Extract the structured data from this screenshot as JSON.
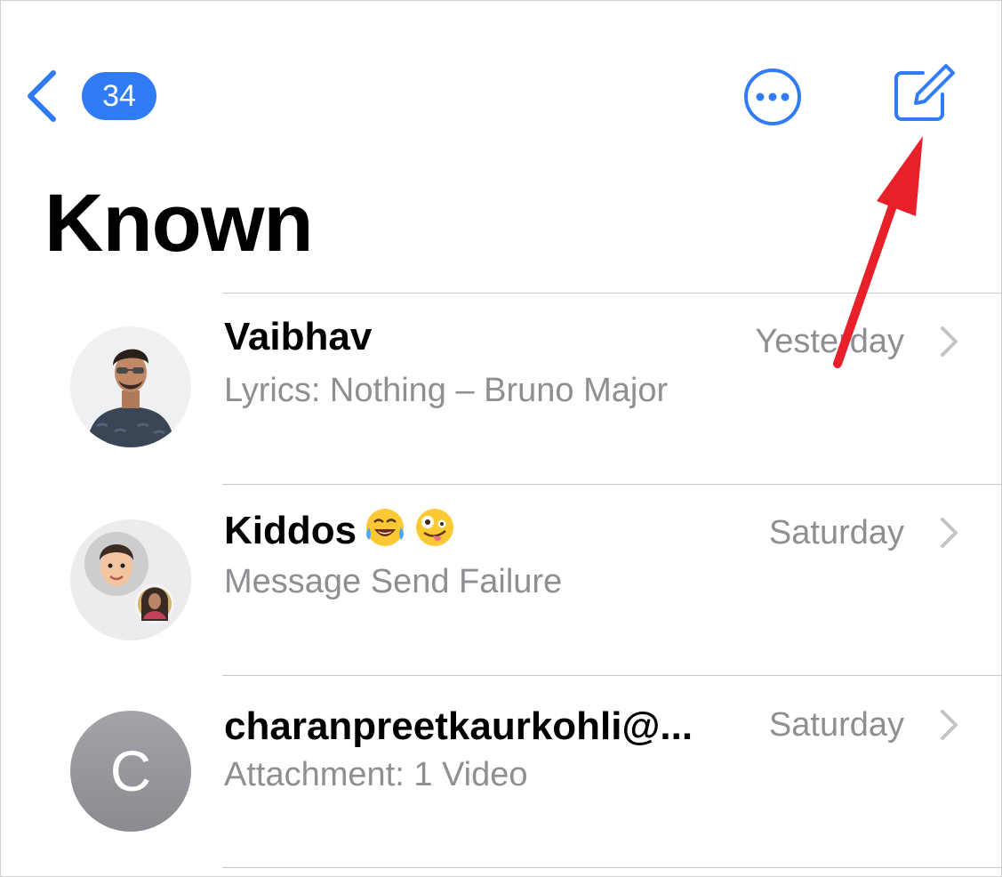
{
  "nav": {
    "unread_count": "34",
    "back_icon": "chevron-left-icon",
    "more_icon": "ellipsis-circle-icon",
    "compose_icon": "compose-icon"
  },
  "page_title": "Known",
  "colors": {
    "accent": "#2f7cf6",
    "secondary_text": "#8e8e93",
    "annotation_arrow": "#e8202a"
  },
  "conversations": [
    {
      "name": "Vaibhav",
      "preview": "Lyrics: Nothing – Bruno Major",
      "time": "Yesterday",
      "avatar": "photo"
    },
    {
      "name": "Kiddos",
      "name_emojis": [
        "face-with-tears-of-joy-emoji",
        "zany-face-emoji"
      ],
      "preview": "Message Send Failure",
      "time": "Saturday",
      "avatar": "group-photo"
    },
    {
      "name": "charanpreetkaurkohli@...",
      "preview": "Attachment: 1 Video",
      "time": "Saturday",
      "avatar": "letter",
      "avatar_letter": "C"
    }
  ]
}
